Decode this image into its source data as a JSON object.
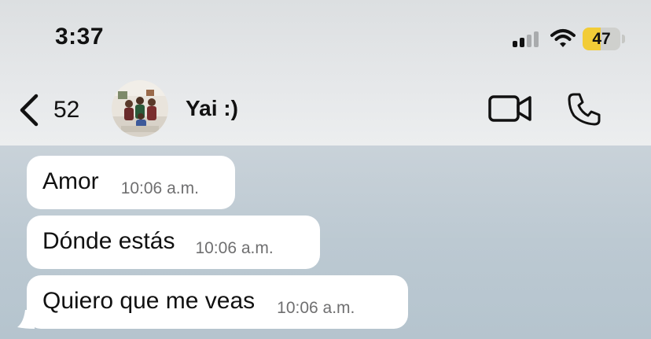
{
  "status_bar": {
    "time": "3:37",
    "battery_level": "47",
    "battery_fraction": 0.47,
    "signal_bars_active": 2,
    "signal_bars_total": 4,
    "battery_color": "#f2cc37"
  },
  "header": {
    "back_count": "52",
    "contact_name": "Yai :)",
    "icons": [
      "chevron-left-icon",
      "video-call-icon",
      "phone-call-icon"
    ]
  },
  "messages": [
    {
      "text": "Amor",
      "time": "10:06 a.m."
    },
    {
      "text": "Dónde estás",
      "time": "10:06 a.m."
    },
    {
      "text": "Quiero que me veas",
      "time": "10:06 a.m."
    }
  ],
  "colors": {
    "bubble": "#ffffff",
    "chat_background": "#bcc9d2",
    "header_background": "#e6e8ea"
  }
}
